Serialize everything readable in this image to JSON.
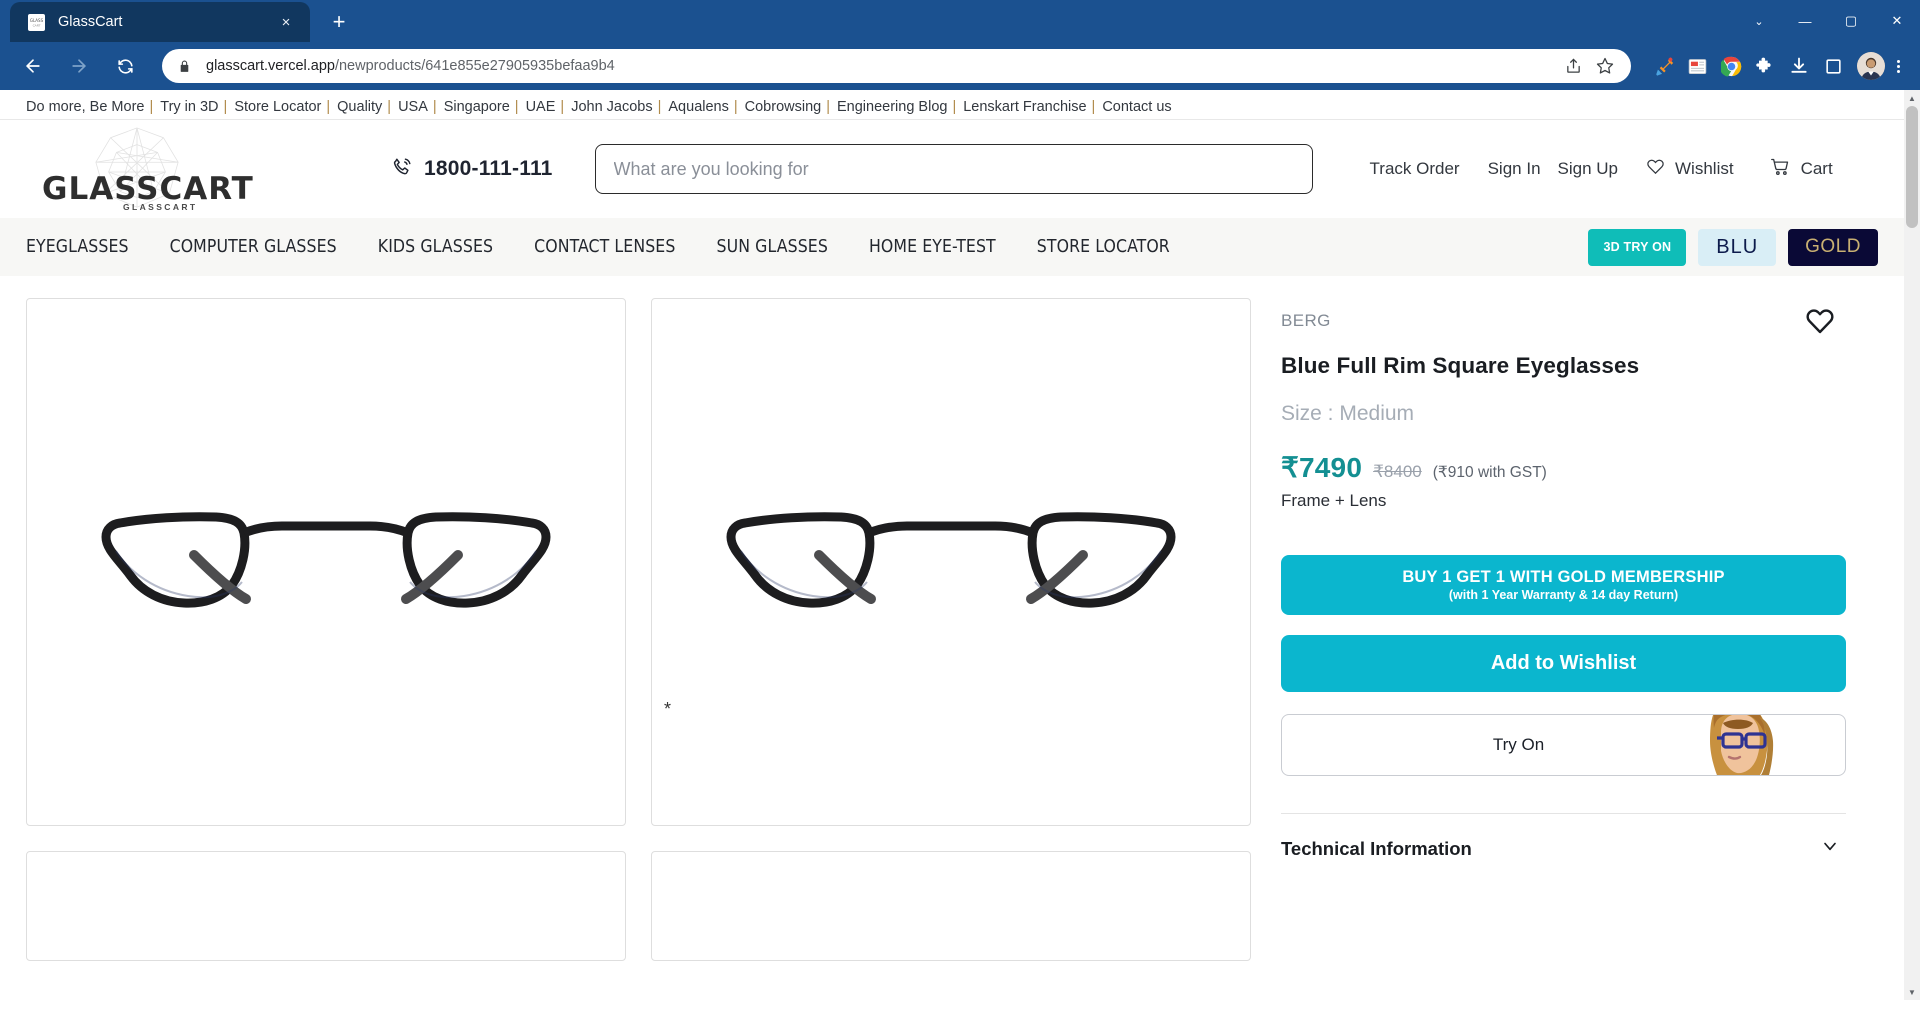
{
  "browser": {
    "tab": {
      "title": "GlassCart",
      "favicon": "glasscart-favicon",
      "close": "×"
    },
    "new_tab": "+",
    "window_controls": {
      "chevron": "⌄",
      "minimize": "—",
      "maximize": "▢",
      "close": "✕"
    },
    "nav": {
      "back": "←",
      "forward": "→",
      "reload": "⟳"
    },
    "omnibox": {
      "lock_icon": "lock-icon",
      "url_domain": "glasscart.vercel.app",
      "url_path": "/newproducts/641e855e27905935befaa9b4",
      "share_icon": "share-icon",
      "bookmark_icon": "star-icon"
    },
    "extensions": [
      "eyedropper-icon",
      "news-reader-icon",
      "chrome-icon",
      "puzzle-icon",
      "download-icon",
      "sidepanel-icon"
    ],
    "profile_avatar": "user-avatar",
    "menu": "kebab-menu-icon"
  },
  "topbar": {
    "links": [
      "Do more, Be More",
      "Try in 3D",
      "Store Locator",
      "Quality",
      "USA",
      "Singapore",
      "UAE",
      "John Jacobs",
      "Aqualens",
      "Cobrowsing",
      "Engineering Blog",
      "Lenskart Franchise",
      "Contact us"
    ],
    "separator": "|"
  },
  "header": {
    "logo_text": "GLASSCART",
    "logo_sub": "GLASSCART",
    "phone_icon": "phone-icon",
    "phone": "1800-111-111",
    "search_placeholder": "What are you looking for",
    "search_value": "",
    "track_order": "Track Order",
    "sign_in": "Sign In",
    "sign_up": "Sign Up",
    "wishlist": "Wishlist",
    "wishlist_icon": "heart-icon",
    "cart": "Cart",
    "cart_icon": "cart-icon"
  },
  "navbar": {
    "items": [
      "EYEGLASSES",
      "COMPUTER GLASSES",
      "KIDS GLASSES",
      "CONTACT LENSES",
      "SUN GLASSES",
      "HOME EYE-TEST",
      "STORE LOCATOR"
    ],
    "badges": [
      {
        "label": "3D TRY ON",
        "bg": "#0fbdb8",
        "fg": "#ffffff"
      },
      {
        "label": "BLU",
        "bg": "#d9eef6",
        "fg": "#0d1b4c"
      },
      {
        "label": "GOLD",
        "bg": "#0a0936",
        "fg": "#c9b072"
      }
    ]
  },
  "gallery": {
    "image_alt": "black square eyeglasses front view",
    "marker": "*"
  },
  "product": {
    "wishlist_icon": "heart-outline-icon",
    "brand": "BERG",
    "title": "Blue Full Rim Square Eyeglasses",
    "size": "Size : Medium",
    "price": "₹7490",
    "mrp": "₹8400",
    "gst": "(₹910 with GST)",
    "frame_lens": "Frame + Lens",
    "buy_button_line1": "BUY 1 GET 1 WITH GOLD MEMBERSHIP",
    "buy_button_line2": "(with 1 Year Warranty & 14 day Return)",
    "wishlist_button": "Add to Wishlist",
    "tryon_button": "Try On",
    "tryon_image": "model-wearing-glasses",
    "technical_information": "Technical Information",
    "technical_chevron": "chevron-down-icon",
    "colors": {
      "accent": "#0bb6ce",
      "price": "#138f92",
      "gold": "#c9b072"
    }
  },
  "scrollbar": {
    "up": "▲",
    "down": "▼"
  }
}
